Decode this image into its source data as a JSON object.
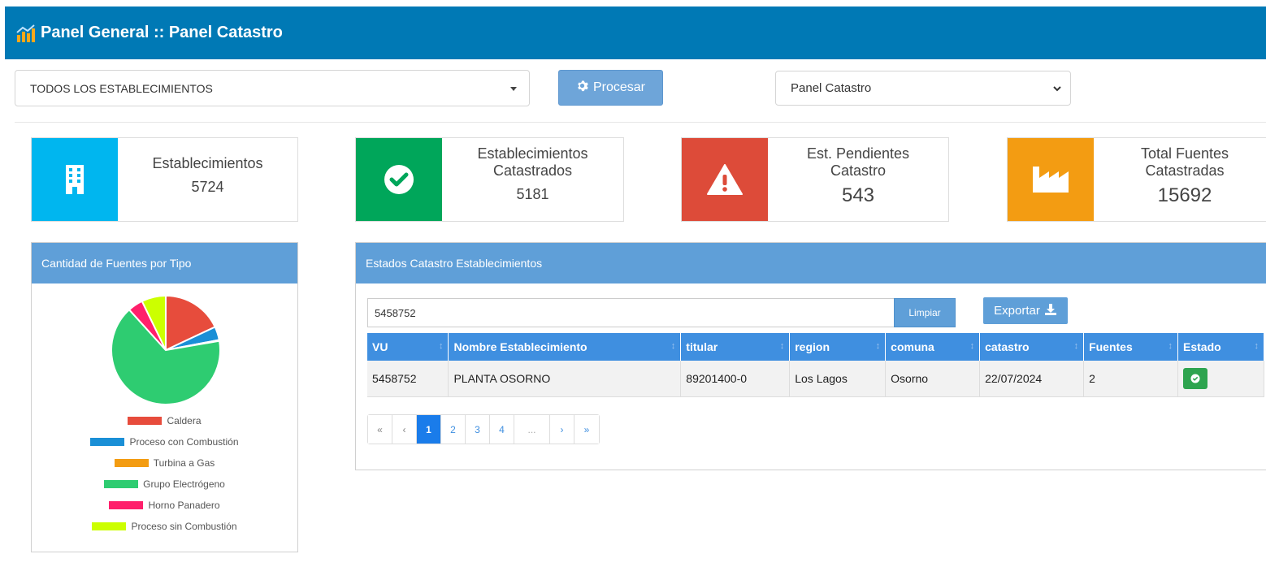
{
  "header": {
    "title": "Panel General :: Panel Catastro"
  },
  "filters": {
    "establishment_select": "TODOS LOS ESTABLECIMIENTOS",
    "process_label": "Procesar",
    "panel_select": "Panel Catastro"
  },
  "stats": [
    {
      "label": "Establecimientos",
      "value": "5724",
      "color": "#00b6ef",
      "icon": "building-icon"
    },
    {
      "label": "Establecimientos Catastrados",
      "value": "5181",
      "color": "#00a65a",
      "icon": "check-circle-icon"
    },
    {
      "label": "Est. Pendientes Catastro",
      "value": "543",
      "color": "#dd4b39",
      "icon": "warning-icon"
    },
    {
      "label": "Total Fuentes Catastradas",
      "value": "15692",
      "color": "#f39c12",
      "icon": "industry-icon"
    }
  ],
  "fuentes_panel": {
    "title": "Cantidad de Fuentes por Tipo"
  },
  "chart_data": {
    "type": "pie",
    "categories": [
      "Caldera",
      "Proceso con Combustión",
      "Turbina a Gas",
      "Grupo Electrógeno",
      "Horno Panadero",
      "Proceso sin Combustión"
    ],
    "values": [
      18,
      4,
      0.3,
      66,
      4.5,
      7.2
    ],
    "colors": [
      "#e74c3c",
      "#1a8fd6",
      "#f39c12",
      "#2ecc71",
      "#ff1f6b",
      "#ccff00"
    ],
    "legend": "bottom"
  },
  "estados_panel": {
    "title": "Estados Catastro Establecimientos",
    "search_value": "5458752",
    "clear_label": "Limpiar",
    "export_label": "Exportar",
    "columns": [
      "VU",
      "Nombre Establecimiento",
      "titular",
      "region",
      "comuna",
      "catastro",
      "Fuentes",
      "Estado"
    ],
    "rows": [
      [
        "5458752",
        "PLANTA OSORNO",
        "89201400-0",
        "Los Lagos",
        "Osorno",
        "22/07/2024",
        "2"
      ]
    ],
    "pager": [
      "«",
      "‹",
      "1",
      "2",
      "3",
      "4",
      "...",
      "›",
      "»"
    ]
  }
}
